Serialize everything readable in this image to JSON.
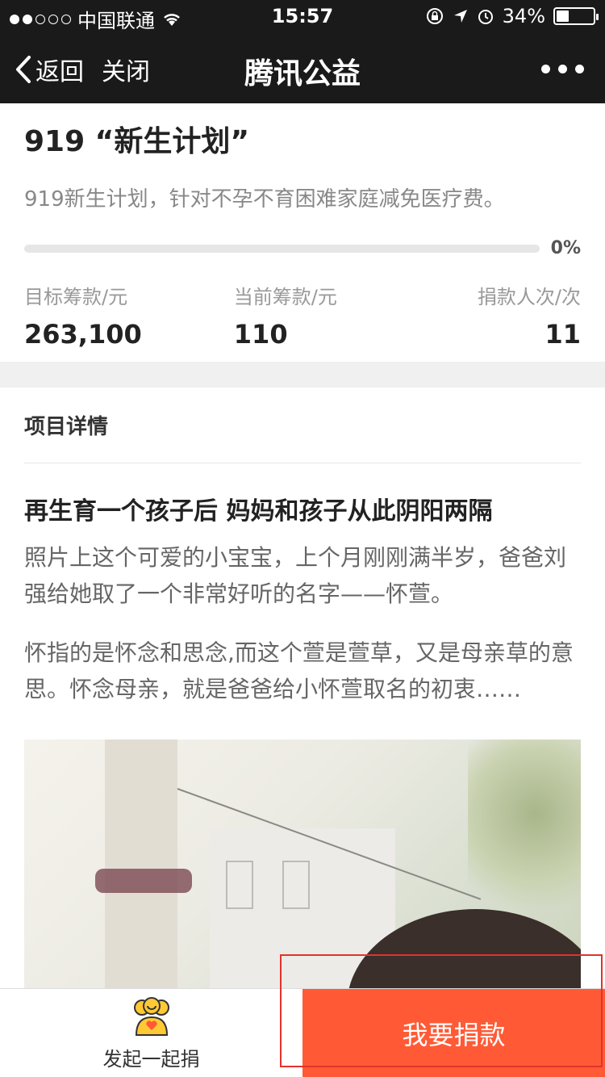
{
  "status_bar": {
    "carrier": "中国联通",
    "time": "15:57",
    "battery": "34%",
    "battery_level": 0.34
  },
  "nav": {
    "back_label": "返回",
    "close_label": "关闭",
    "title": "腾讯公益"
  },
  "project": {
    "title": "919 “新生计划”",
    "description": "919新生计划，针对不孕不育困难家庭减免医疗费。",
    "progress_percent": 0,
    "progress_label": "0%",
    "stats": {
      "target_label": "目标筹款/元",
      "target_value": "263,100",
      "current_label": "当前筹款/元",
      "current_value": "110",
      "donors_label": "捐款人次/次",
      "donors_value": "11"
    }
  },
  "details": {
    "section_title": "项目详情",
    "article_title": "再生育一个孩子后 妈妈和孩子从此阴阳两隔",
    "paragraph_1": "照片上这个可爱的小宝宝，上个月刚刚满半岁，爸爸刘强给她取了一个非常好听的名字——怀萱。",
    "paragraph_2": "怀指的是怀念和思念,而这个萱是萱草，又是母亲草的意思。怀念母亲，就是爸爸给小怀萱取名的初衷……"
  },
  "bottom": {
    "together_label": "发起一起捐",
    "donate_label": "我要捐款"
  },
  "colors": {
    "accent": "#ff5a35",
    "highlight": "#e4322b"
  }
}
